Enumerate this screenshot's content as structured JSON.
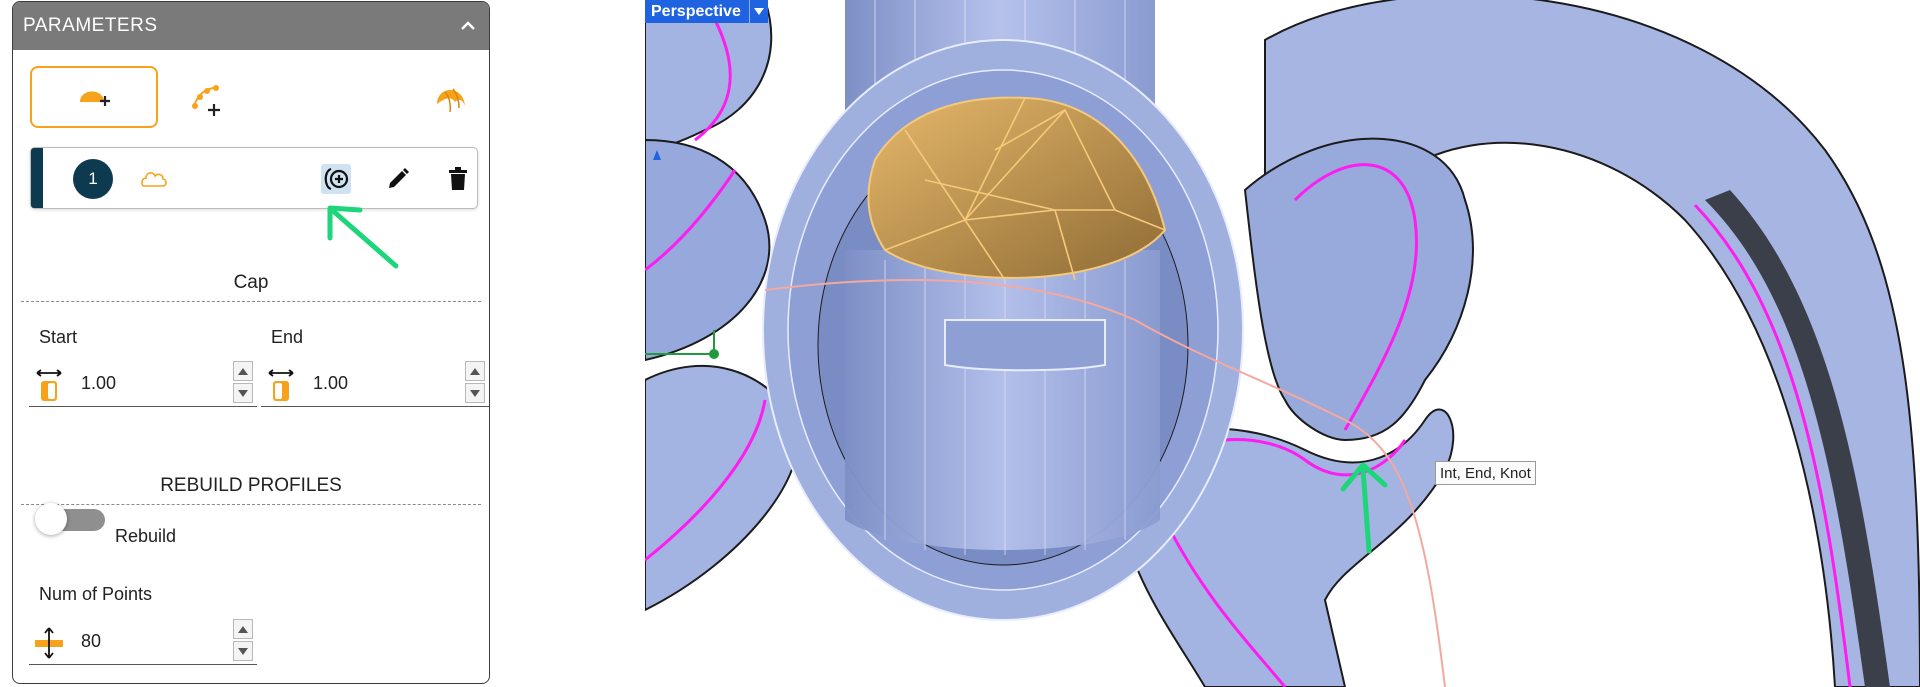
{
  "panel": {
    "title": "PARAMETERS",
    "profile": {
      "number": "1"
    },
    "cap": {
      "title": "Cap",
      "start_label": "Start",
      "start_value": "1.00",
      "end_label": "End",
      "end_value": "1.00"
    },
    "rebuild": {
      "title": "REBUILD PROFILES",
      "toggle_label": "Rebuild",
      "toggle_on": false,
      "points_label": "Num of Points",
      "points_value": "80"
    }
  },
  "viewport": {
    "view_name": "Perspective",
    "snap_tooltip": "Int, End, Knot"
  },
  "colors": {
    "accent_orange": "#f7a21b",
    "badge_navy": "#0e3a4f",
    "annotation_green": "#1ed67a",
    "viewport_label_blue": "#1f63e0",
    "surface_blue": "#a3b3e2",
    "curve_magenta": "#ff1cf0"
  },
  "icons": [
    "chevron-up-icon",
    "cap-add-icon",
    "points-add-icon",
    "cap-shape-icon",
    "cloud-outline-icon",
    "add-ring-icon",
    "edit-pencil-icon",
    "trash-icon",
    "cap-start-icon",
    "cap-end-icon",
    "num-points-icon",
    "dropdown-arrow-icon"
  ]
}
